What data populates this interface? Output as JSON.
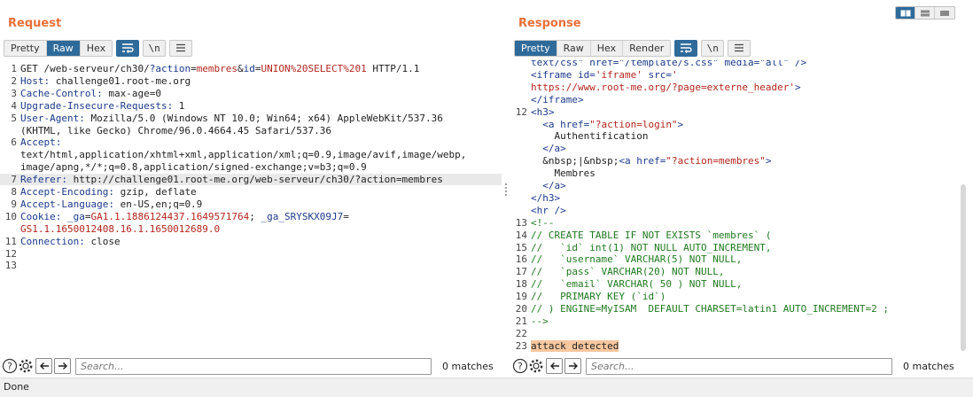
{
  "request": {
    "title": "Request",
    "tabs": [
      "Pretty",
      "Raw",
      "Hex"
    ],
    "active_tab": "Raw",
    "newline_btn": "\\n",
    "lines": [
      {
        "n": "1",
        "parts": [
          [
            "v",
            "GET /web-serveur/ch30/"
          ],
          [
            "k",
            "?action"
          ],
          [
            "v",
            "="
          ],
          [
            "r",
            "membres"
          ],
          [
            "v",
            "&"
          ],
          [
            "k",
            "id"
          ],
          [
            "v",
            "="
          ],
          [
            "r",
            "UNION%20SELECT%201"
          ],
          [
            "v",
            " HTTP/1.1"
          ]
        ]
      },
      {
        "n": "2",
        "parts": [
          [
            "k",
            "Host:"
          ],
          [
            "v",
            " challenge01.root-me.org"
          ]
        ]
      },
      {
        "n": "3",
        "parts": [
          [
            "k",
            "Cache-Control:"
          ],
          [
            "v",
            " max-age=0"
          ]
        ]
      },
      {
        "n": "4",
        "parts": [
          [
            "k",
            "Upgrade-Insecure-Requests:"
          ],
          [
            "v",
            " 1"
          ]
        ]
      },
      {
        "n": "5",
        "parts": [
          [
            "k",
            "User-Agent:"
          ],
          [
            "v",
            " Mozilla/5.0 (Windows NT 10.0; Win64; x64) AppleWebKit/537.36"
          ]
        ]
      },
      {
        "n": "",
        "parts": [
          [
            "v",
            "(KHTML, like Gecko) Chrome/96.0.4664.45 Safari/537.36"
          ]
        ]
      },
      {
        "n": "6",
        "parts": [
          [
            "k",
            "Accept:"
          ]
        ]
      },
      {
        "n": "",
        "parts": [
          [
            "v",
            "text/html,application/xhtml+xml,application/xml;q=0.9,image/avif,image/webp,"
          ]
        ]
      },
      {
        "n": "",
        "parts": [
          [
            "v",
            "image/apng,*/*;q=0.8,application/signed-exchange;v=b3;q=0.9"
          ]
        ]
      },
      {
        "n": "7",
        "parts": [
          [
            "k",
            "Referer:"
          ],
          [
            "v",
            " http://challenge01.root-me.org/web-serveur/ch30/?action=membres"
          ]
        ],
        "hl": true
      },
      {
        "n": "8",
        "parts": [
          [
            "k",
            "Accept-Encoding:"
          ],
          [
            "v",
            " gzip, deflate"
          ]
        ]
      },
      {
        "n": "9",
        "parts": [
          [
            "k",
            "Accept-Language:"
          ],
          [
            "v",
            " en-US,en;q=0.9"
          ]
        ]
      },
      {
        "n": "10",
        "parts": [
          [
            "k",
            "Cookie:"
          ],
          [
            "v",
            " "
          ],
          [
            "k",
            "_ga"
          ],
          [
            "v",
            "="
          ],
          [
            "r",
            "GA1.1.1886124437.1649571764"
          ],
          [
            "v",
            "; "
          ],
          [
            "k",
            "_ga_SRYSKX09J7"
          ],
          [
            "v",
            "="
          ]
        ]
      },
      {
        "n": "",
        "parts": [
          [
            "r",
            "GS1.1.1650012408.16.1.1650012689.0"
          ]
        ]
      },
      {
        "n": "11",
        "parts": [
          [
            "k",
            "Connection:"
          ],
          [
            "v",
            " close"
          ]
        ]
      },
      {
        "n": "12",
        "parts": []
      },
      {
        "n": "13",
        "parts": []
      }
    ],
    "search_placeholder": "Search...",
    "matches": "0 matches"
  },
  "response": {
    "title": "Response",
    "tabs": [
      "Pretty",
      "Raw",
      "Hex",
      "Render"
    ],
    "active_tab": "Pretty",
    "newline_btn": "\\n",
    "lines": [
      {
        "n": "",
        "parts": [
          [
            "attr",
            "text/css\" href=\"/template/s.css\" media=\"all\" />"
          ]
        ]
      },
      {
        "n": "",
        "parts": [
          [
            "tag",
            "<iframe"
          ],
          [
            "attr",
            " id="
          ],
          [
            "str",
            "'iframe'"
          ],
          [
            "attr",
            " src="
          ],
          [
            "str",
            "'"
          ]
        ]
      },
      {
        "n": "",
        "parts": [
          [
            "str",
            "https://www.root-me.org/?page=externe_header'"
          ],
          [
            "tag",
            ">"
          ]
        ]
      },
      {
        "n": "",
        "parts": [
          [
            "tag",
            "</iframe>"
          ]
        ]
      },
      {
        "n": "12",
        "parts": [
          [
            "tag",
            "<h3>"
          ]
        ]
      },
      {
        "n": "",
        "parts": [
          [
            "txt",
            "  "
          ],
          [
            "tag",
            "<a"
          ],
          [
            "attr",
            " href="
          ],
          [
            "str",
            "\"?action=login\""
          ],
          [
            "tag",
            ">"
          ]
        ]
      },
      {
        "n": "",
        "parts": [
          [
            "txt",
            "    Authentification"
          ]
        ]
      },
      {
        "n": "",
        "parts": [
          [
            "txt",
            "  "
          ],
          [
            "tag",
            "</a>"
          ]
        ]
      },
      {
        "n": "",
        "parts": [
          [
            "txt",
            "  &nbsp;|&nbsp;"
          ],
          [
            "tag",
            "<a"
          ],
          [
            "attr",
            " href="
          ],
          [
            "str",
            "\"?action=membres\""
          ],
          [
            "tag",
            ">"
          ]
        ]
      },
      {
        "n": "",
        "parts": [
          [
            "txt",
            "    Membres"
          ]
        ]
      },
      {
        "n": "",
        "parts": [
          [
            "txt",
            "  "
          ],
          [
            "tag",
            "</a>"
          ]
        ]
      },
      {
        "n": "",
        "parts": [
          [
            "tag",
            "</h3>"
          ]
        ]
      },
      {
        "n": "",
        "parts": [
          [
            "tag",
            "<hr />"
          ]
        ]
      },
      {
        "n": "13",
        "parts": [
          [
            "cm",
            "<!--"
          ]
        ]
      },
      {
        "n": "14",
        "parts": [
          [
            "cm",
            "// CREATE TABLE IF NOT EXISTS `membres` ("
          ]
        ]
      },
      {
        "n": "15",
        "parts": [
          [
            "cm",
            "//   `id` int(1) NOT NULL AUTO_INCREMENT,"
          ]
        ]
      },
      {
        "n": "16",
        "parts": [
          [
            "cm",
            "//   `username` VARCHAR(5) NOT NULL,"
          ]
        ]
      },
      {
        "n": "17",
        "parts": [
          [
            "cm",
            "//   `pass` VARCHAR(20) NOT NULL,"
          ]
        ]
      },
      {
        "n": "18",
        "parts": [
          [
            "cm",
            "//   `email` VARCHAR( 50 ) NOT NULL,"
          ]
        ]
      },
      {
        "n": "19",
        "parts": [
          [
            "cm",
            "//   PRIMARY KEY (`id`)"
          ]
        ]
      },
      {
        "n": "20",
        "parts": [
          [
            "cm",
            "// ) ENGINE=MyISAM  DEFAULT CHARSET=latin1 AUTO_INCREMENT=2 ;"
          ]
        ]
      },
      {
        "n": "21",
        "parts": [
          [
            "cm",
            "-->"
          ]
        ]
      },
      {
        "n": "22",
        "parts": []
      },
      {
        "n": "23",
        "parts": [
          [
            "atk",
            "attack detected"
          ]
        ]
      }
    ],
    "search_placeholder": "Search...",
    "matches": "0 matches"
  },
  "status": "Done"
}
